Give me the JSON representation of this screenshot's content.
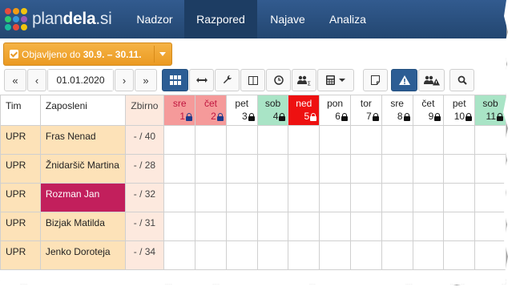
{
  "brand": {
    "prefix": "plan",
    "bold": "dela",
    "suffix": ".si"
  },
  "nav": [
    {
      "label": "Nadzor",
      "active": false
    },
    {
      "label": "Razpored",
      "active": true
    },
    {
      "label": "Najave",
      "active": false
    },
    {
      "label": "Analiza",
      "active": false
    }
  ],
  "publish": {
    "text": "Objavljeno do",
    "range": "30.9. – 30.11."
  },
  "toolbar": {
    "first": "«",
    "prev": "‹",
    "date": "01.01.2020",
    "next": "›",
    "last": "»"
  },
  "table": {
    "headers": {
      "team": "Tim",
      "employee": "Zaposleni",
      "sum": "Zbirno"
    },
    "days": [
      {
        "name": "sre",
        "num": "1",
        "color": "#f59a9a",
        "text": "#c0163f",
        "lock": "#1d3a8a"
      },
      {
        "name": "čet",
        "num": "2",
        "color": "#f59a9a",
        "text": "#c0163f",
        "lock": "#1d3a8a"
      },
      {
        "name": "pet",
        "num": "3",
        "color": "#ffffff",
        "text": "#222222",
        "lock": "#111111"
      },
      {
        "name": "sob",
        "num": "4",
        "color": "#a9e4c6",
        "text": "#222222",
        "lock": "#111111"
      },
      {
        "name": "ned",
        "num": "5",
        "color": "#ee1111",
        "text": "#ffffff",
        "lock": "#ffffff"
      },
      {
        "name": "pon",
        "num": "6",
        "color": "#ffffff",
        "text": "#222222",
        "lock": "#111111"
      },
      {
        "name": "tor",
        "num": "7",
        "color": "#ffffff",
        "text": "#222222",
        "lock": "#111111"
      },
      {
        "name": "sre",
        "num": "8",
        "color": "#ffffff",
        "text": "#222222",
        "lock": "#111111"
      },
      {
        "name": "čet",
        "num": "9",
        "color": "#ffffff",
        "text": "#222222",
        "lock": "#111111"
      },
      {
        "name": "pet",
        "num": "10",
        "color": "#ffffff",
        "text": "#222222",
        "lock": "#111111"
      },
      {
        "name": "sob",
        "num": "11",
        "color": "#a9e4c6",
        "text": "#222222",
        "lock": "#111111"
      }
    ],
    "rows": [
      {
        "team": "UPR",
        "employee": "Fras Nenad",
        "sum": "- / 40",
        "selected": false
      },
      {
        "team": "UPR",
        "employee": "Žnidaršič Martina",
        "sum": "- / 28",
        "selected": false
      },
      {
        "team": "UPR",
        "employee": "Rozman Jan",
        "sum": "- / 32",
        "selected": true
      },
      {
        "team": "UPR",
        "employee": "Bizjak Matilda",
        "sum": "- / 31",
        "selected": false
      },
      {
        "team": "UPR",
        "employee": "Jenko Doroteja",
        "sum": "- / 34",
        "selected": false
      }
    ]
  },
  "colors": {
    "navbar": "#2b4f7d",
    "active_nav": "#1d3d63",
    "publish": "#f0a030",
    "accent_blue": "#2c5d94",
    "selected_row": "#c21f5c"
  }
}
